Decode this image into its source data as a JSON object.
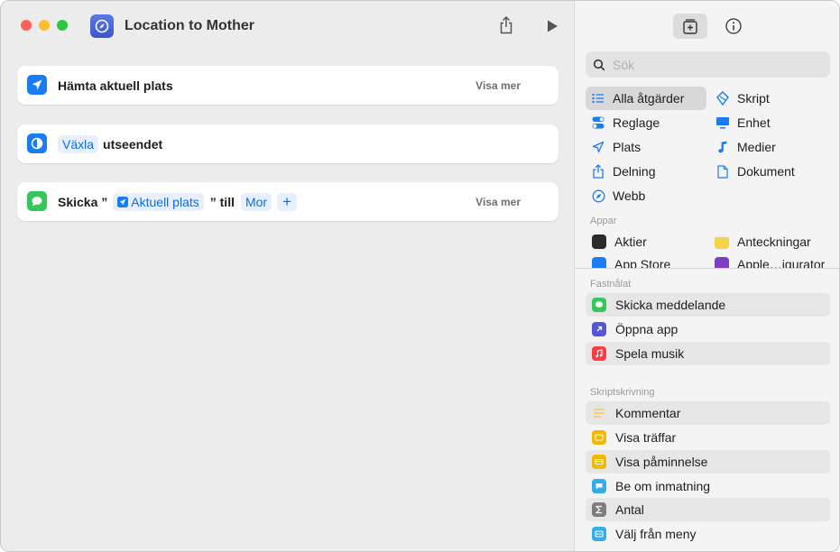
{
  "window": {
    "title": "Location to Mother"
  },
  "actions": [
    {
      "label": "Hämta aktuell plats",
      "more": "Visa mer"
    },
    {
      "token": "Växla",
      "label": "utseendet"
    },
    {
      "prefix": "Skicka ”",
      "token_location": "Aktuell plats",
      "middle": "” till",
      "token_recipient": "Mor",
      "plus": "+",
      "more": "Visa mer"
    }
  ],
  "sidebar": {
    "search_placeholder": "Sök",
    "categories": [
      {
        "label": "Alla åtgärder",
        "icon": "list-icon"
      },
      {
        "label": "Skript",
        "icon": "script-icon"
      },
      {
        "label": "Reglage",
        "icon": "toggle-icon"
      },
      {
        "label": "Enhet",
        "icon": "display-icon"
      },
      {
        "label": "Plats",
        "icon": "location-icon"
      },
      {
        "label": "Medier",
        "icon": "music-note-icon"
      },
      {
        "label": "Delning",
        "icon": "share-icon"
      },
      {
        "label": "Dokument",
        "icon": "document-icon"
      },
      {
        "label": "Webb",
        "icon": "compass-icon"
      }
    ],
    "apps_label": "Appar",
    "apps": [
      {
        "label": "Aktier",
        "color": "#2b2b2b"
      },
      {
        "label": "Anteckningar",
        "color": "#f5d34a"
      },
      {
        "label": "App Store",
        "color": "#1e7cf2"
      },
      {
        "label": "Apple…igurator",
        "color": "#7b3fc6"
      }
    ],
    "pinned_label": "Fastnålat",
    "pinned": [
      {
        "label": "Skicka meddelande",
        "color": "#34c759"
      },
      {
        "label": "Öppna app",
        "color": "#5856d6"
      },
      {
        "label": "Spela musik",
        "color": "#fc3c44"
      }
    ],
    "scripting_label": "Skriptskrivning",
    "scripting": [
      {
        "label": "Kommentar",
        "color": "#f7c948"
      },
      {
        "label": "Visa träffar",
        "color": "#f5b800"
      },
      {
        "label": "Visa påminnelse",
        "color": "#f5b800"
      },
      {
        "label": "Be om inmatning",
        "color": "#32ade6"
      },
      {
        "label": "Antal",
        "color": "#7d7d7d"
      },
      {
        "label": "Välj från meny",
        "color": "#32ade6"
      }
    ]
  }
}
